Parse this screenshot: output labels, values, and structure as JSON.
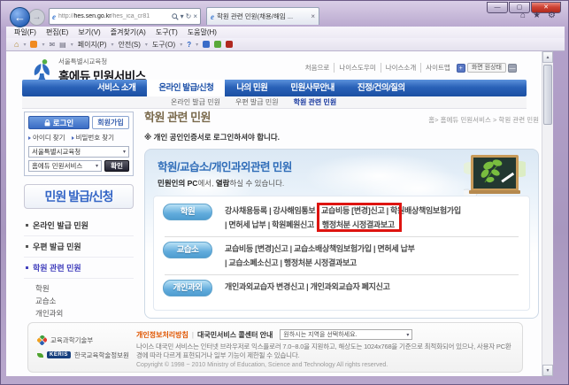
{
  "browser": {
    "url_protocol": "http://",
    "url_domain": "hes.sen.go.kr",
    "url_path": "/hes_ica_cr81",
    "tab_title": "학원 관련 민원(채용/해임 ...",
    "menu": [
      "파일(F)",
      "편집(E)",
      "보기(V)",
      "즐겨찾기(A)",
      "도구(T)",
      "도움말(H)"
    ],
    "commandbar": {
      "page": "페이지(P)",
      "safety": "안전(S)",
      "tools": "도구(O)"
    }
  },
  "icons": {
    "back": "←",
    "forward": "→",
    "dropdown": "▾",
    "refresh": "↻",
    "stop": "×",
    "home": "⌂",
    "star": "★",
    "gear": "⚙",
    "minimize": "—",
    "maximize": "▢",
    "close": "✕",
    "tab_close": "×",
    "mail": "✉",
    "print": "▤",
    "help": "?",
    "up": "▲",
    "down": "▼",
    "plus": "+",
    "minus": "—"
  },
  "header": {
    "org": "서울특별시교육청",
    "service": "홈에듀 민원서비스",
    "links": [
      "처음으로",
      "나이스도우미",
      "나이스소개",
      "사이트맵"
    ],
    "screen_reset": "화면 원상태"
  },
  "nav": {
    "items": [
      "서비스 소개",
      "온라인 발급/신청",
      "나의 민원",
      "민원사무안내",
      "진정/건의/질의"
    ],
    "sub": [
      "온라인 발급 민원",
      "우편 발급 민원",
      "학원 관련 민원"
    ]
  },
  "sidebar": {
    "login": "로그인",
    "signup": "회원가입",
    "find_id": "아이디 찾기",
    "find_pw": "비밀번호 찾기",
    "org_select": "서울특별시교육청",
    "service_select": "홈에듀 민원서비스",
    "confirm": "확인",
    "section_title": "민원 발급/신청",
    "menu": [
      "온라인 발급 민원",
      "우편 발급 민원",
      "학원 관련 민원"
    ],
    "submenu": [
      "학원",
      "교습소",
      "개인과외"
    ]
  },
  "main": {
    "title": "학원 관련 민원",
    "breadcrumb": "홈> 홈에듀 민원서비스 > 학원 관련 민원",
    "notice": "※ 개인 공인인증서로 로그인하셔야 합니다.",
    "panel_title": "학원/교습소/개인과외관련 민원",
    "desc_bold1": "민원인의 PC",
    "desc_mid": "에서, ",
    "desc_bold2": "열람",
    "desc_tail": "하실 수 있습니다.",
    "rows": [
      {
        "label": "학원",
        "line1": "강사채용등록  |  강사해임통보  |  교습비등 [변경]신고  |  학원배상책임보험가입",
        "line2": "|  면허세 납부  |  학원폐원신고  |",
        "highlight": "행정처분 시정결과보고"
      },
      {
        "label": "교습소",
        "line1": "교습비등 [변경]신고  |  교습소배상책임보험가입  |  면허세 납부",
        "line2": "|  교습소폐소신고  |  행정처분 시정결과보고"
      },
      {
        "label": "개인과외",
        "line1": "개인과외교습자 변경신고  |  개인과외교습자 폐지신고"
      }
    ]
  },
  "footer": {
    "ministry": "교육과학기술부",
    "keris_badge": "KERIS",
    "keris": "한국교육학술정보원",
    "privacy": "개인정보처리방침",
    "callcenter": "대국민서비스 콜센터 안내",
    "region_placeholder": "원하시는 지역을 선택하세요.",
    "notice": "나이스 대국민 서비스는 인터넷 브라우저로 익스플로러 7.0~8.0을 지원하고, 해상도는 1024x768을 기준으로 최적화되어 있으나, 사용자 PC환경에 따라 다르게 표현되거나 일부 기능이 제한될 수 있습니다.",
    "copyright": "Copyright © 1998 ~ 2010 Ministry of Education, Science and Technology All rights reserved."
  },
  "colors": {
    "nav_blue": "#2a62b8",
    "highlight_red": "#de1410",
    "row_button_blue": "#62acdc",
    "privacy_orange": "#e05500"
  }
}
